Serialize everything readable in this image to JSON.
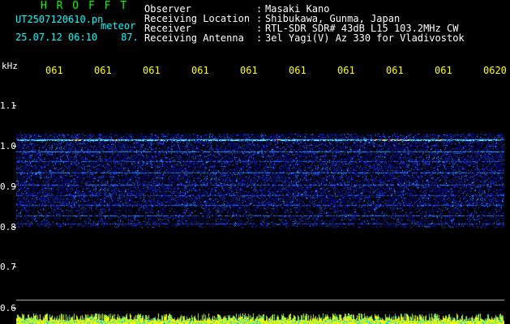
{
  "header": {
    "title": "H R O F F T",
    "filename": "UT2507120610.pn",
    "meteor_label": "meteor",
    "datetime": "25.07.12 06:10",
    "count": "87.",
    "meta": [
      {
        "label": "Observer",
        "value": "Masaki Kano"
      },
      {
        "label": "Receiving Location",
        "value": "Shibukawa, Gunma, Japan"
      },
      {
        "label": "Receiver",
        "value": "RTL-SDR SDR# 43dB L15 103.2MHz CW"
      },
      {
        "label": "Receiving Antenna",
        "value": "3el Yagi(V) Az 330 for Vladivostok"
      }
    ],
    "separator": ":"
  },
  "axis": {
    "unit": "kHz",
    "y_labels": [
      "1.1",
      "1.0",
      "0.9",
      "0.8",
      "0.7",
      "0.6"
    ],
    "x_labels": [
      "061",
      "061",
      "061",
      "061",
      "061",
      "061",
      "061",
      "061",
      "061",
      "0620"
    ]
  },
  "colors": {
    "background": "#000000",
    "noise": "#0000aa",
    "band": "#3366ff",
    "strong": "#00ffff",
    "peak": "#ff3300",
    "x_labels": "#ffff00",
    "header_cyan": "#00ffff",
    "header_title": "#00ff00"
  }
}
